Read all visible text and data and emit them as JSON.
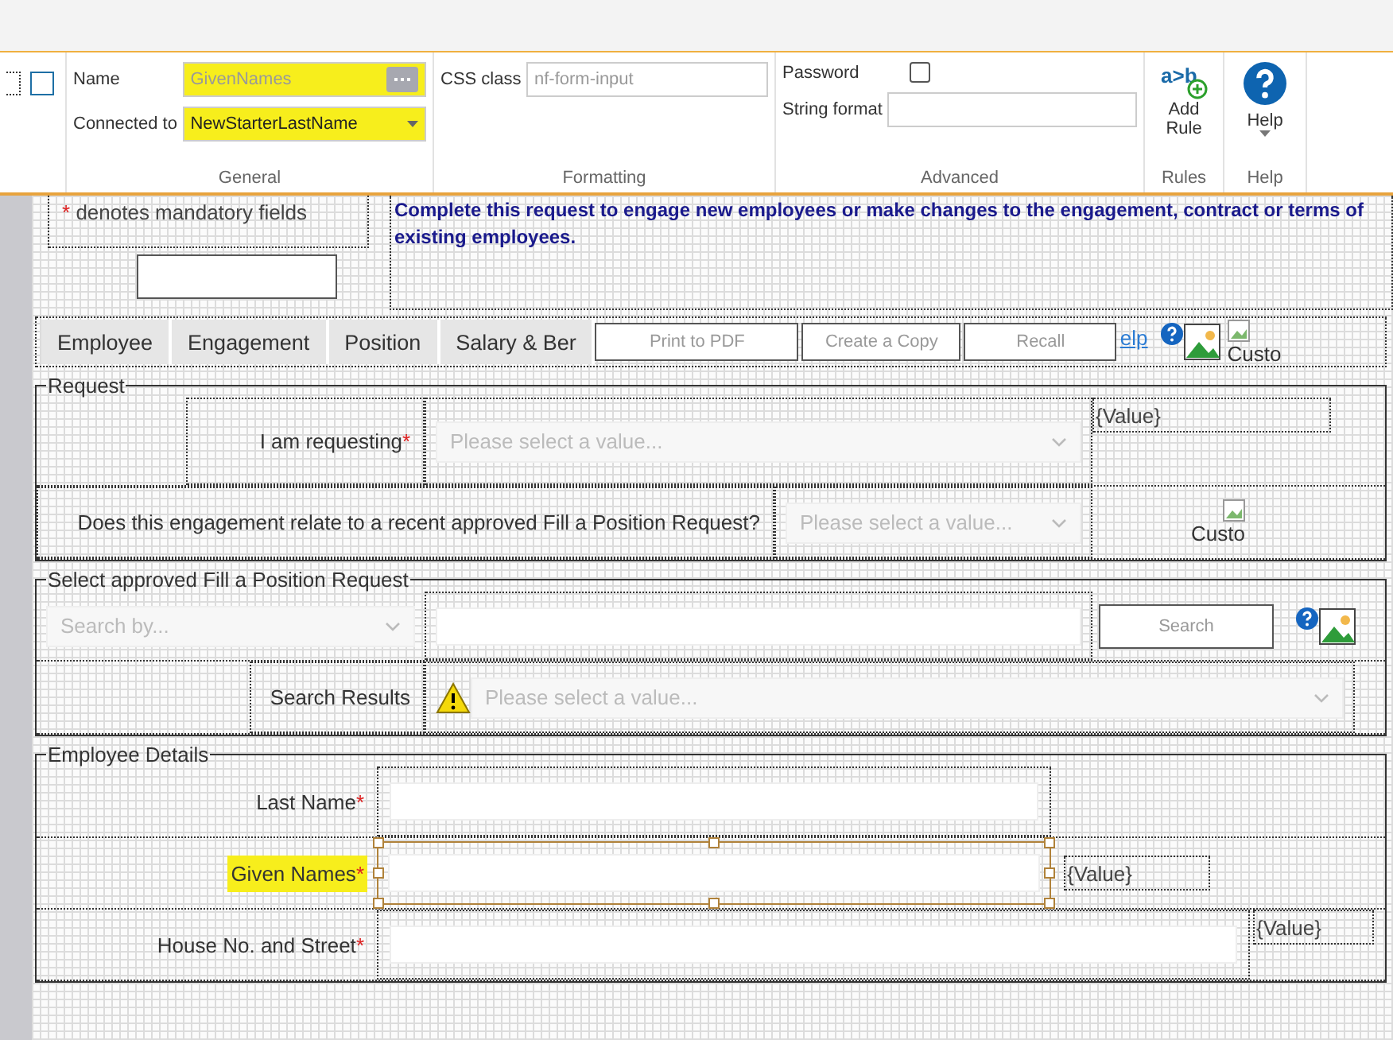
{
  "ribbon": {
    "general": {
      "title": "General",
      "name_label": "Name",
      "name_value": "GivenNames",
      "connected_label": "Connected to",
      "connected_value": "NewStarterLastName",
      "highlighted": true
    },
    "formatting": {
      "title": "Formatting",
      "css_label": "CSS class",
      "css_value": "nf-form-input"
    },
    "advanced": {
      "title": "Advanced",
      "password_label": "Password",
      "password_checked": false,
      "format_label": "String format"
    },
    "rules": {
      "title": "Rules",
      "icon_text": "a>b",
      "add_rule": "Add Rule"
    },
    "help": {
      "title": "Help",
      "button": "Help"
    }
  },
  "header": {
    "required_mark": "*",
    "mandatory_note": "denotes mandatory fields",
    "intro": "Complete this request to engage new employees or make changes to the engagement, contract or terms of existing employees."
  },
  "tabs": [
    {
      "label": "Employee"
    },
    {
      "label": "Engagement"
    },
    {
      "label": "Position"
    },
    {
      "label": "Salary & Ber"
    }
  ],
  "toolbar": {
    "buttons": [
      "Print to PDF",
      "Create a Copy",
      "Recall"
    ],
    "help_link": "elp",
    "image_caption": "Custo"
  },
  "request": {
    "legend": "Request",
    "requesting_label": "I am requesting",
    "requesting_required": true,
    "requesting_placeholder": "Please select a value...",
    "requesting_value": "{Value}",
    "fill_question": "Does this engagement relate to a recent approved Fill a Position Request?",
    "fill_placeholder": "Please select a value...",
    "image_caption": "Custo"
  },
  "fill_position": {
    "legend": "Select approved Fill a Position Request",
    "search_by_placeholder": "Search by...",
    "search_button": "Search",
    "results_label": "Search Results",
    "results_placeholder": "Please select a value..."
  },
  "employee_details": {
    "legend": "Employee Details",
    "fields": [
      {
        "label": "Last Name",
        "required": true,
        "selected": false,
        "highlighted": false,
        "kind": "short"
      },
      {
        "label": "Given Names",
        "required": true,
        "selected": true,
        "highlighted": true,
        "kind": "short",
        "value_tag": "{Value}"
      },
      {
        "label": "House No. and Street",
        "required": true,
        "selected": false,
        "highlighted": false,
        "kind": "wide",
        "value_tag": "{Value}"
      }
    ]
  }
}
